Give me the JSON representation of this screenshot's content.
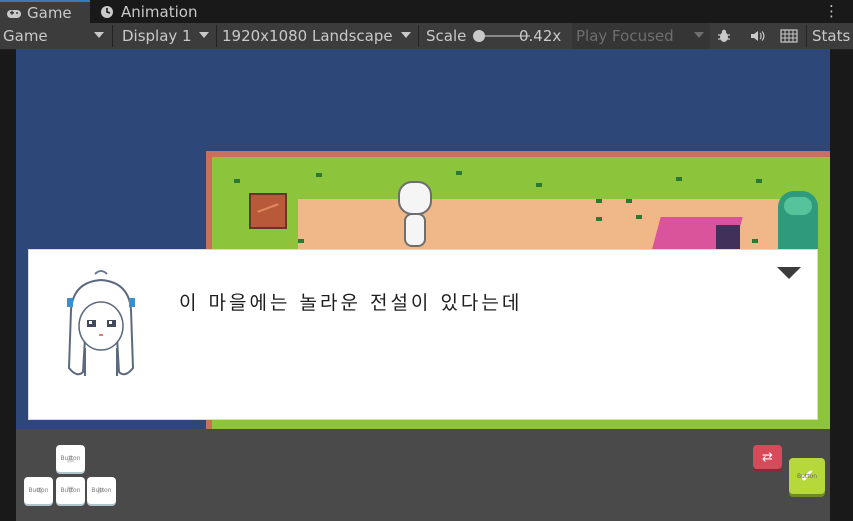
{
  "tabs": [
    {
      "label": "Game",
      "icon": "gamepad-icon"
    },
    {
      "label": "Animation",
      "icon": "clock-icon"
    }
  ],
  "toolbar": {
    "game_dropdown": "Game",
    "display_dropdown": "Display 1",
    "resolution_dropdown": "1920x1080 Landscape",
    "scale_label": "Scale",
    "scale_value": "0.42x",
    "play_mode": "Play Focused",
    "stats_label": "Stats"
  },
  "dialog": {
    "text": "이 마을에는 놀라운 전설이 있다는데"
  },
  "controls": {
    "up_label": "Button",
    "left_label": "Button",
    "down_label": "Button",
    "right_label": "Button",
    "confirm_label": "Button"
  },
  "colors": {
    "sky": "#2d4778",
    "grass": "#8cc43c",
    "path": "#f0b888",
    "confirm": "#b6d83a",
    "swap": "#d64a5a"
  }
}
